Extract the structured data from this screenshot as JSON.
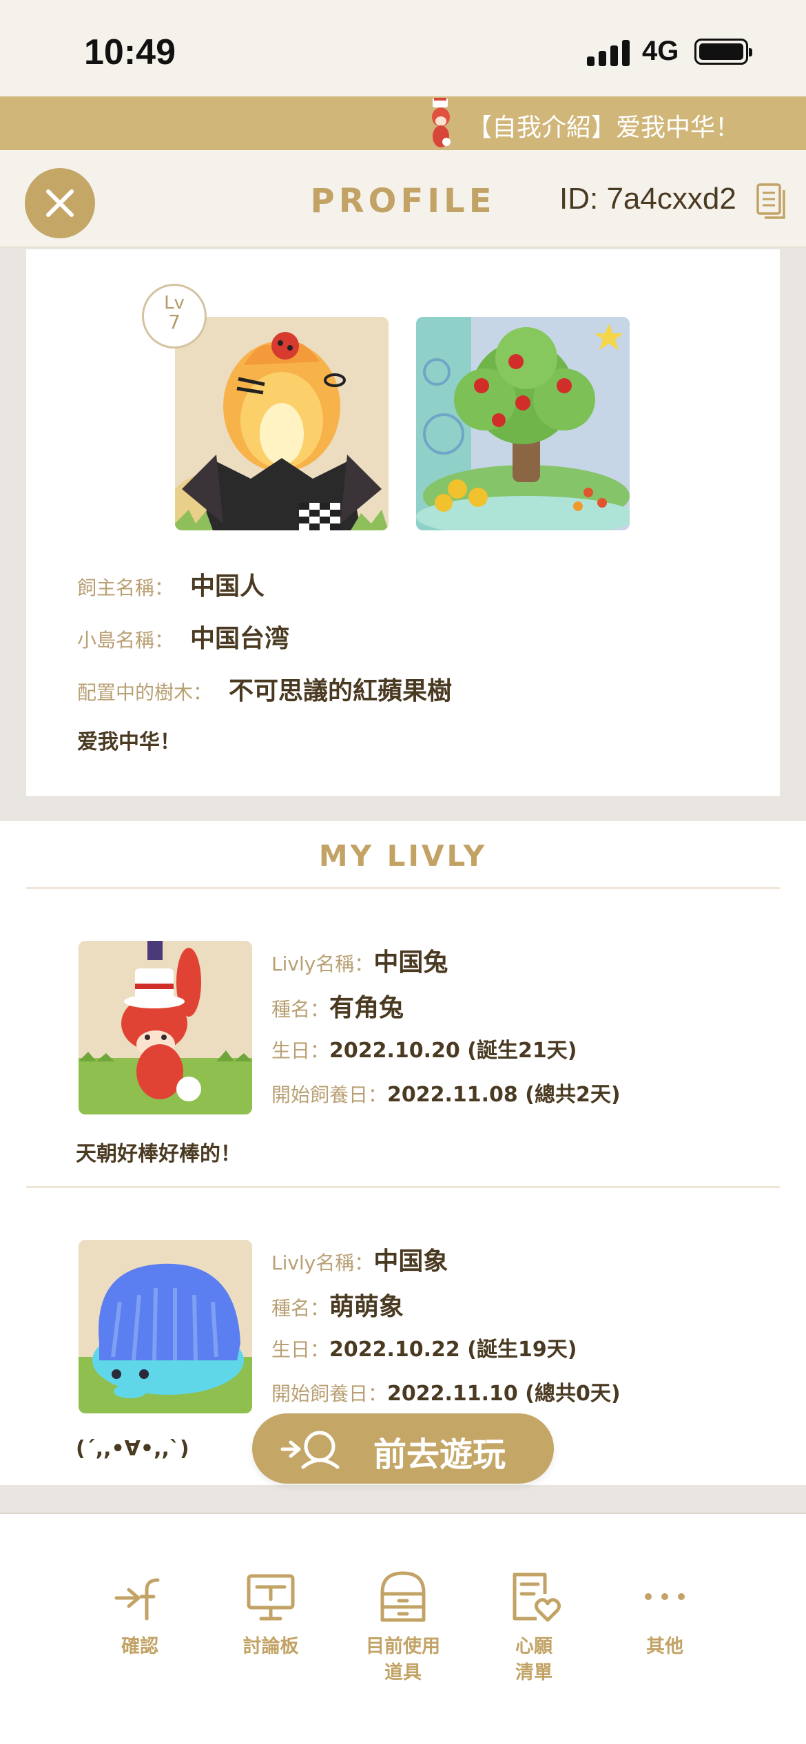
{
  "status_bar": {
    "time": "10:49",
    "network": "4G"
  },
  "marquee": {
    "text": "【自我介紹】爱我中华！"
  },
  "header": {
    "title": "PROFILE",
    "id_label": "ID: 7a4cxxd2"
  },
  "profile": {
    "level_prefix": "Lv",
    "level": "7",
    "owner_label": "飼主名稱：",
    "owner_name": "中国人",
    "island_label": "小島名稱：",
    "island_name": "中国台湾",
    "tree_label": "配置中的樹木：",
    "tree_name": "不可思議的紅蘋果樹",
    "bio": "爱我中华！"
  },
  "livly_section": {
    "title": "MY LIVLY",
    "items": [
      {
        "name_label": "Livly名稱：",
        "name": "中国兔",
        "species_label": "種名：",
        "species": "有角兔",
        "birthday_label": "生日：",
        "birthday": "2022.10.20 (誕生21天)",
        "start_label": "開始飼養日：",
        "start": "2022.11.08 (總共2天)",
        "comment": "天朝好棒好棒的！"
      },
      {
        "name_label": "Livly名稱：",
        "name": "中国象",
        "species_label": "種名：",
        "species": "萌萌象",
        "birthday_label": "生日：",
        "birthday": "2022.10.22 (誕生19天)",
        "start_label": "開始飼養日：",
        "start": "2022.11.10 (總共0天)",
        "comment": "(´,,•∀•,,`)"
      }
    ]
  },
  "play_button": {
    "label": "前去遊玩"
  },
  "bottom_nav": {
    "items": [
      {
        "label": "確認",
        "icon": "checkin-icon"
      },
      {
        "label": "討論板",
        "icon": "board-icon"
      },
      {
        "label": "目前使用\n道具",
        "icon": "items-icon"
      },
      {
        "label": "心願\n清單",
        "icon": "wishlist-icon"
      },
      {
        "label": "其他",
        "icon": "more-icon"
      }
    ]
  },
  "colors": {
    "gold": "#c2a365",
    "marquee": "#d1b67a",
    "text": "#4a3a22",
    "label": "#b9a074"
  }
}
